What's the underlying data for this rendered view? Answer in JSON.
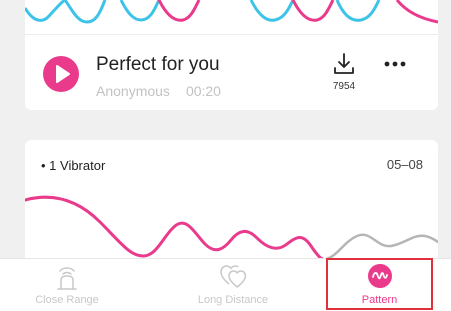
{
  "track": {
    "title": "Perfect for you",
    "author": "Anonymous",
    "duration": "00:20",
    "downloads": "7954",
    "play_icon": "play-icon",
    "download_icon": "download-icon",
    "more_icon": "more-dots-icon"
  },
  "pattern_card": {
    "device_label": "• 1 Vibrator",
    "date": "05–08"
  },
  "bottom_nav": {
    "items": [
      {
        "label": "Close Range",
        "icon": "close-range-icon",
        "active": false
      },
      {
        "label": "Long Distance",
        "icon": "long-distance-icon",
        "active": false
      },
      {
        "label": "Pattern",
        "icon": "pattern-icon",
        "active": true
      }
    ]
  },
  "colors": {
    "accent": "#ea3a8c",
    "wave_secondary": "#3ec3e8",
    "wave_inactive": "#b5b5b5",
    "highlight_box": "#e0303a",
    "background": "#f0f0f0"
  }
}
